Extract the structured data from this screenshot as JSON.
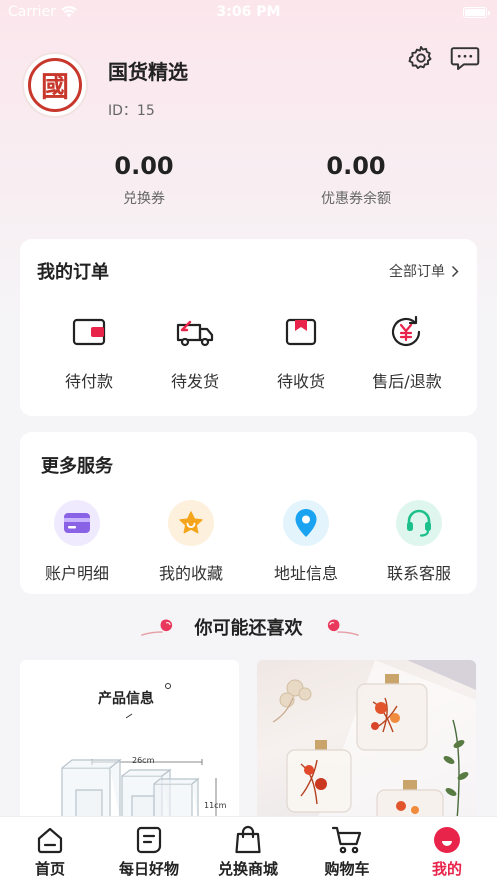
{
  "status_bar": {
    "carrier": "Carrier",
    "time": "3:06 PM"
  },
  "profile": {
    "avatar_glyph": "國",
    "shop_name": "国货精选",
    "id_label": "ID：15"
  },
  "stats": [
    {
      "value": "0.00",
      "label": "兑换券"
    },
    {
      "value": "0.00",
      "label": "优惠券余额"
    }
  ],
  "orders": {
    "title": "我的订单",
    "all_link": "全部订单",
    "items": [
      {
        "label": "待付款",
        "icon": "wallet-icon"
      },
      {
        "label": "待发货",
        "icon": "truck-icon"
      },
      {
        "label": "待收货",
        "icon": "package-icon"
      },
      {
        "label": "售后/退款",
        "icon": "refund-icon"
      }
    ]
  },
  "services": {
    "title": "更多服务",
    "items": [
      {
        "label": "账户明细",
        "icon": "card-icon",
        "color": "#8a62e6"
      },
      {
        "label": "我的收藏",
        "icon": "star-icon",
        "color": "#f5a51c"
      },
      {
        "label": "地址信息",
        "icon": "location-icon",
        "color": "#1aa3f0"
      },
      {
        "label": "联系客服",
        "icon": "headset-icon",
        "color": "#1cc08a"
      }
    ]
  },
  "recommend": {
    "title": "你可能还喜欢"
  },
  "products": [
    {
      "title": "产品信息",
      "dim_width": "26cm",
      "dim_height": "11cm"
    },
    {
      "title": ""
    }
  ],
  "tabbar": {
    "items": [
      {
        "label": "首页",
        "icon": "home-icon"
      },
      {
        "label": "每日好物",
        "icon": "daily-icon"
      },
      {
        "label": "兑换商城",
        "icon": "bag-icon"
      },
      {
        "label": "购物车",
        "icon": "cart-icon"
      },
      {
        "label": "我的",
        "icon": "profile-icon"
      }
    ],
    "active_index": 4,
    "active_color": "#e8244a"
  },
  "colors": {
    "accent": "#e8244a",
    "brand_red": "#c8372b"
  }
}
